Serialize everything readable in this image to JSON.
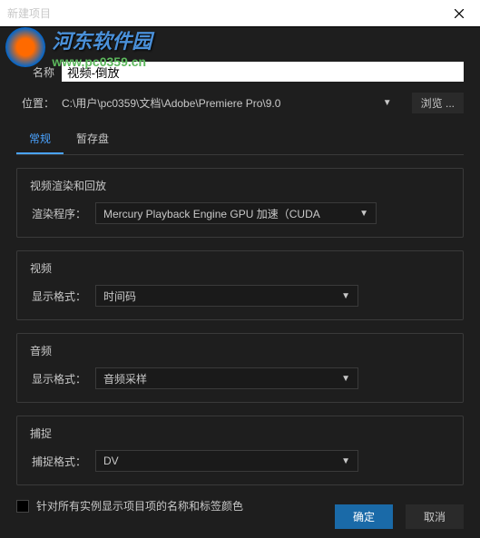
{
  "titlebar": {
    "title": "新建项目"
  },
  "watermark": {
    "main": "河东软件园",
    "url": "www.pc0359.cn"
  },
  "nameRow": {
    "label": "名称",
    "value": "视频-倒放"
  },
  "locRow": {
    "label": "位置：",
    "value": "C:\\用户\\pc0359\\文档\\Adobe\\Premiere Pro\\9.0",
    "browse": "浏览 ..."
  },
  "tabs": {
    "general": "常规",
    "scratch": "暂存盘"
  },
  "renderGroup": {
    "title": "视频渲染和回放",
    "label": "渲染程序：",
    "value": "Mercury Playback Engine GPU 加速（CUDA"
  },
  "videoGroup": {
    "title": "视频",
    "label": "显示格式：",
    "value": "时间码"
  },
  "audioGroup": {
    "title": "音频",
    "label": "显示格式：",
    "value": "音频采样"
  },
  "captureGroup": {
    "title": "捕捉",
    "label": "捕捉格式：",
    "value": "DV"
  },
  "checkboxLabel": "针对所有实例显示项目项的名称和标签颜色",
  "footer": {
    "ok": "确定",
    "cancel": "取消"
  }
}
